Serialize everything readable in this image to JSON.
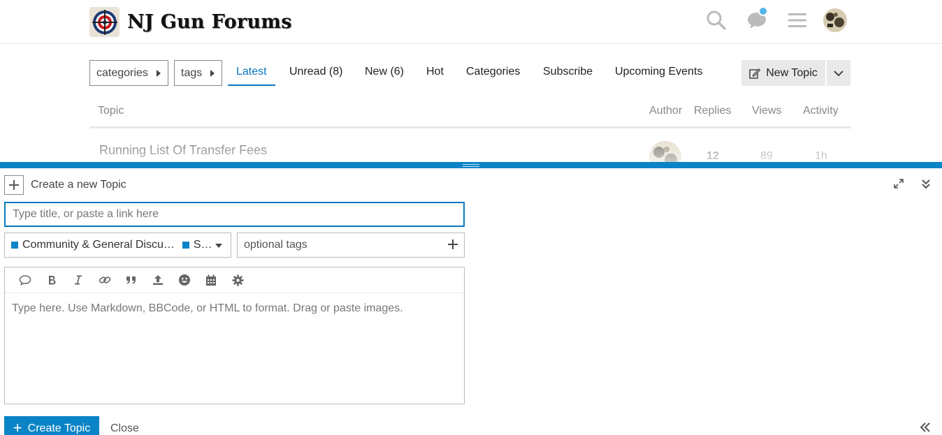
{
  "header": {
    "site_title": "NJ Gun Forums",
    "icons": [
      "search-icon",
      "chat-icon",
      "hamburger-icon",
      "user-avatar"
    ],
    "accent_color": "#0a84c6"
  },
  "nav": {
    "categories_dropdown": "categories",
    "tags_dropdown": "tags",
    "links": [
      "Latest",
      "Unread (8)",
      "New (6)",
      "Hot",
      "Categories",
      "Subscribe",
      "Upcoming Events"
    ],
    "active": "Latest",
    "new_topic_label": "New Topic"
  },
  "topic_list": {
    "columns": [
      "Topic",
      "Author",
      "Replies",
      "Views",
      "Activity"
    ],
    "rows": [
      {
        "title": "Running List Of Transfer Fees",
        "replies": "12",
        "views": "89",
        "activity": "1h"
      }
    ]
  },
  "composer": {
    "action_label": "Create a new Topic",
    "title_placeholder": "Type title, or paste a link here",
    "category": "Community & General Discu…",
    "subcategory": "S…",
    "tags_placeholder": "optional tags",
    "editor_placeholder": "Type here. Use Markdown, BBCode, or HTML to format. Drag or paste images.",
    "toolbar_icons": [
      "speech-bubble-icon",
      "bold-icon",
      "italic-icon",
      "link-icon",
      "quote-icon",
      "upload-icon",
      "emoji-icon",
      "calendar-icon",
      "gear-icon"
    ],
    "submit_label": "Create Topic",
    "close_label": "Close"
  }
}
